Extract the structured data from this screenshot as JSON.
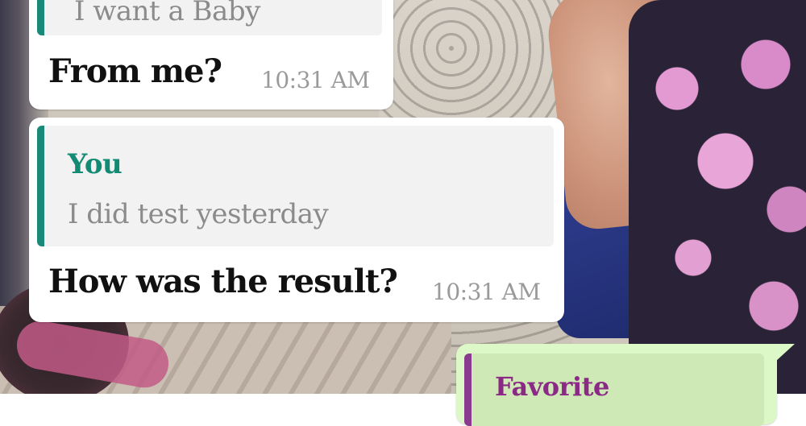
{
  "colors": {
    "quote_bar_you": "#1a8a78",
    "quote_author_you": "#138a73",
    "quote_bar_outgoing": "#8a3a8f",
    "quote_author_outgoing": "#8a2a86",
    "incoming_bubble": "#ffffff",
    "outgoing_bubble": "#dcf8c6",
    "timestamp": "#9a9a9a"
  },
  "messages": [
    {
      "direction": "incoming",
      "quote": {
        "text": "I want a Baby"
      },
      "text": "From me?",
      "time": "10:31 AM"
    },
    {
      "direction": "incoming",
      "quote": {
        "author": "You",
        "text": "I did test yesterday"
      },
      "text": "How was the result?",
      "time": "10:31 AM"
    },
    {
      "direction": "outgoing",
      "quote": {
        "author": "Favorite"
      }
    }
  ]
}
